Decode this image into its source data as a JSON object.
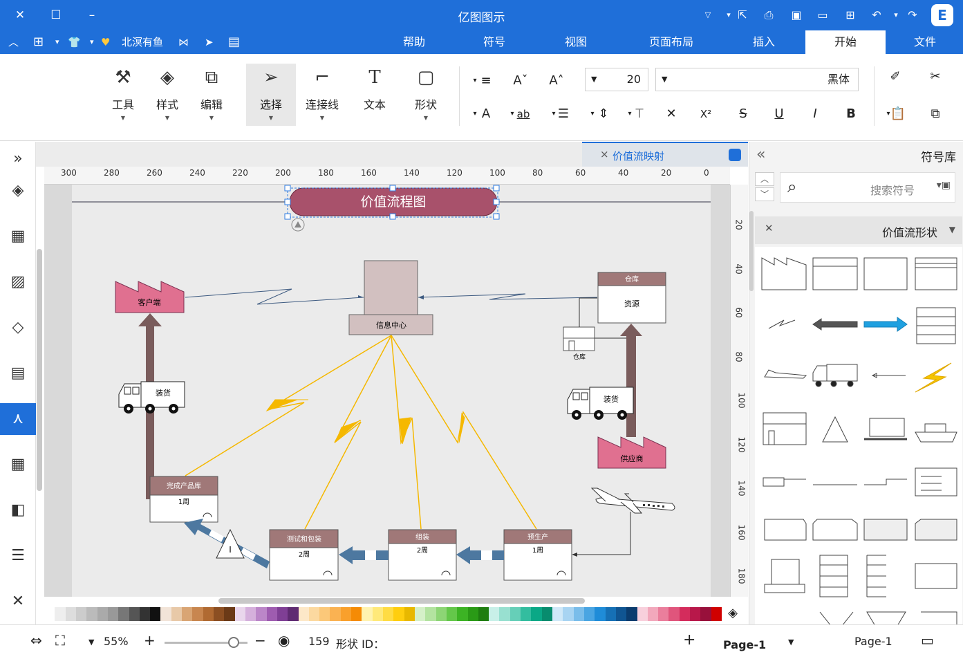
{
  "app": {
    "title": "亿图图示"
  },
  "menu": {
    "tabs": [
      "文件",
      "开始",
      "插入",
      "页面布局",
      "视图",
      "符号",
      "帮助"
    ],
    "active_tab": "开始",
    "user_label": "北溟有鱼"
  },
  "ribbon": {
    "font_name": "黑体",
    "font_size": "20",
    "tools": {
      "shape": "形状",
      "text": "文本",
      "connector": "连接线",
      "select": "选择",
      "edit": "编辑",
      "style": "样式",
      "tool": "工具"
    },
    "format_labels": {
      "bold": "B",
      "italic": "I",
      "underline": "U",
      "strike": "S",
      "superscript": "X²",
      "subscript": "X₂",
      "font_color": "A",
      "highlight": "ab"
    }
  },
  "document": {
    "tab_title": "价值流映射",
    "close": "×"
  },
  "rulers": {
    "h_ticks": [
      "0",
      "20",
      "40",
      "60",
      "80",
      "100",
      "120",
      "140",
      "160",
      "180",
      "200",
      "220",
      "240",
      "260",
      "280",
      "300"
    ],
    "v_ticks": [
      "20",
      "40",
      "60",
      "80",
      "100",
      "120",
      "140",
      "160",
      "180"
    ]
  },
  "diagram": {
    "title": "价值流程图",
    "info_center": "信息中心",
    "customer": "客户端",
    "supplier": "供应商",
    "warehouse_box": {
      "header": "仓库",
      "body": "资源"
    },
    "small_warehouse": "仓库",
    "truck_left": "装货",
    "truck_right": "装货",
    "finished_goods": {
      "header": "完成产品库",
      "body": "1周"
    },
    "test_packaging": {
      "header": "测试和包装",
      "body": "2周"
    },
    "assembly": {
      "header": "组装",
      "body": "2周"
    },
    "production": {
      "header": "预生产",
      "body": "1周"
    },
    "inventory_mark": "I"
  },
  "symbol_library": {
    "title": "符号库",
    "search_placeholder": "搜索符号",
    "category": "价值流形状"
  },
  "status": {
    "page_label": "Page-1",
    "page_tab": "Page-1",
    "shape_id_label": "形状 ID：",
    "shape_id": "159",
    "zoom": "55%"
  },
  "colors": {
    "accent": "#1f6fd9",
    "factory_pink": "#e07090",
    "header_brown": "#a07878",
    "title_capsule": "#a8516b",
    "lightning": "#f5b800",
    "push_arrow": "#4d78a0",
    "pull_arrow": "#7a5c5c"
  },
  "palette": [
    "#ffffff",
    "#eeeeee",
    "#dddddd",
    "#cccccc",
    "#bbbbbb",
    "#aaaaaa",
    "#999999",
    "#777777",
    "#555555",
    "#333333",
    "#111111",
    "#f2e4d8",
    "#e8c9a8",
    "#d9a574",
    "#c8864f",
    "#b06a32",
    "#8c4f22",
    "#6b3a17",
    "#e9d6ec",
    "#d5b0dc",
    "#bb86c8",
    "#9e5cb0",
    "#7f3f95",
    "#5f2b72",
    "#fde8c8",
    "#fcd9a0",
    "#fbc879",
    "#fab252",
    "#f9a02c",
    "#f58b05",
    "#fff3b0",
    "#ffe97a",
    "#ffdc44",
    "#ffce0f",
    "#e8b800",
    "#d5f0c8",
    "#b3e3a0",
    "#8dd575",
    "#64c74a",
    "#3cb324",
    "#2a9a16",
    "#1e7d10",
    "#c8f0e8",
    "#98e0d0",
    "#66cfb8",
    "#33bd9f",
    "#0aa886",
    "#088c6e",
    "#d0e8f8",
    "#a8d4f2",
    "#7abdea",
    "#4aa5e2",
    "#1f8cd8",
    "#1670b5",
    "#105592",
    "#0b3c6e",
    "#f8d0dc",
    "#f2a8bc",
    "#ea7e9c",
    "#e0557c",
    "#d42c5c",
    "#b8184a",
    "#98103b",
    "#d00000"
  ]
}
